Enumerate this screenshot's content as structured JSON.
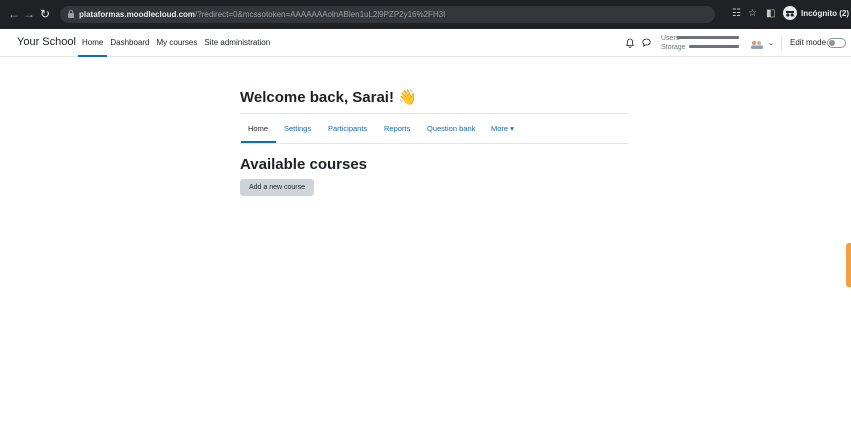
{
  "browser": {
    "url_host": "plataformas.moodlecloud.com",
    "url_path": "/?redirect=0&mcssotoken=AAAAAAAolnABlen1uL2l9PZP2y16%2FH3I",
    "incognito_label": "Incógnito (2)",
    "nav_icons": [
      "back-arrow-icon",
      "forward-arrow-icon",
      "reload-icon",
      "lock-icon"
    ]
  },
  "navbar": {
    "brand": "Your School",
    "items": [
      {
        "label": "Home",
        "active": true
      },
      {
        "label": "Dashboard",
        "active": false
      },
      {
        "label": "My courses",
        "active": false
      },
      {
        "label": "Site administration",
        "active": false
      }
    ],
    "quota": {
      "users_label": "Users",
      "storage_label": "Storage"
    },
    "edit_mode_label": "Edit mode",
    "edit_mode_on": false
  },
  "main": {
    "welcome": "Welcome back, Sarai!",
    "welcome_emoji": "👋",
    "tabs": [
      {
        "label": "Home",
        "active": true
      },
      {
        "label": "Settings",
        "active": false
      },
      {
        "label": "Participants",
        "active": false
      },
      {
        "label": "Reports",
        "active": false
      },
      {
        "label": "Question bank",
        "active": false
      },
      {
        "label": "More ▾",
        "active": false
      }
    ],
    "section_title": "Available courses",
    "add_course_label": "Add a new course"
  },
  "colors": {
    "accent": "#0f6cbf",
    "chrome_bg": "#202124",
    "drawer_handle": "#f0a045"
  }
}
